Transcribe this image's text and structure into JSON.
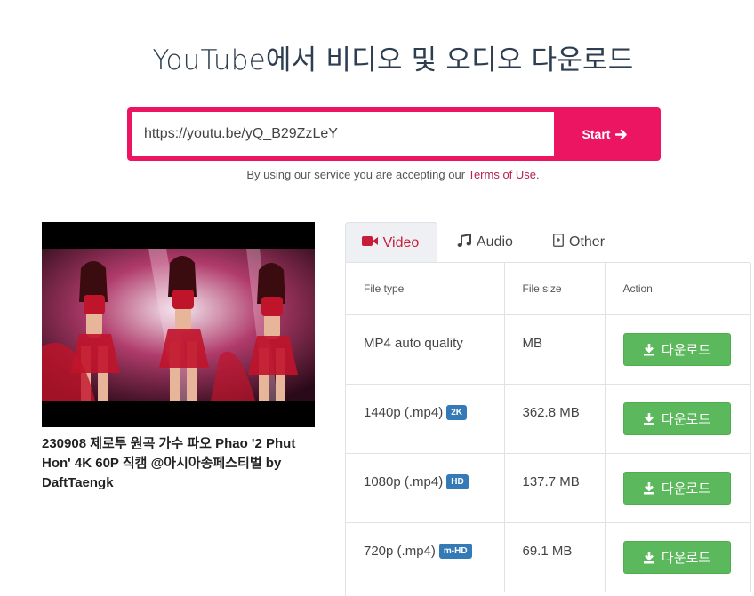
{
  "page": {
    "title": "YouTube에서 비디오 및 오디오 다운로드"
  },
  "search": {
    "value": "https://youtu.be/yQ_B29ZzLeY",
    "start_label": "Start",
    "arrow_icon": "arrow-right-icon"
  },
  "terms": {
    "prefix": "By using our service you are accepting our ",
    "link": "Terms of Use",
    "suffix": "."
  },
  "video": {
    "title": "230908 제로투 원곡 가수 파오 Phao '2 Phut Hon' 4K 60P 직캠 @아시아송페스티벌 by DaftTaengk"
  },
  "tabs": [
    {
      "label": "Video",
      "icon": "video-camera-icon"
    },
    {
      "label": "Audio",
      "icon": "music-note-icon"
    },
    {
      "label": "Other",
      "icon": "file-icon"
    }
  ],
  "table": {
    "headers": {
      "type": "File type",
      "size": "File size",
      "action": "Action"
    },
    "rows": [
      {
        "type": "MP4 auto quality",
        "badge": "",
        "size": "MB",
        "button": "다운로드"
      },
      {
        "type": "1440p (.mp4)",
        "badge": "2K",
        "size": "362.8 MB",
        "button": "다운로드"
      },
      {
        "type": "1080p (.mp4)",
        "badge": "HD",
        "size": "137.7 MB",
        "button": "다운로드"
      },
      {
        "type": "720p (.mp4)",
        "badge": "m-HD",
        "size": "69.1 MB",
        "button": "다운로드"
      }
    ]
  },
  "colors": {
    "accent": "#ec1561",
    "active_tab": "#c81d3a",
    "download_button": "#5cb85c",
    "badge": "#337ab7"
  }
}
